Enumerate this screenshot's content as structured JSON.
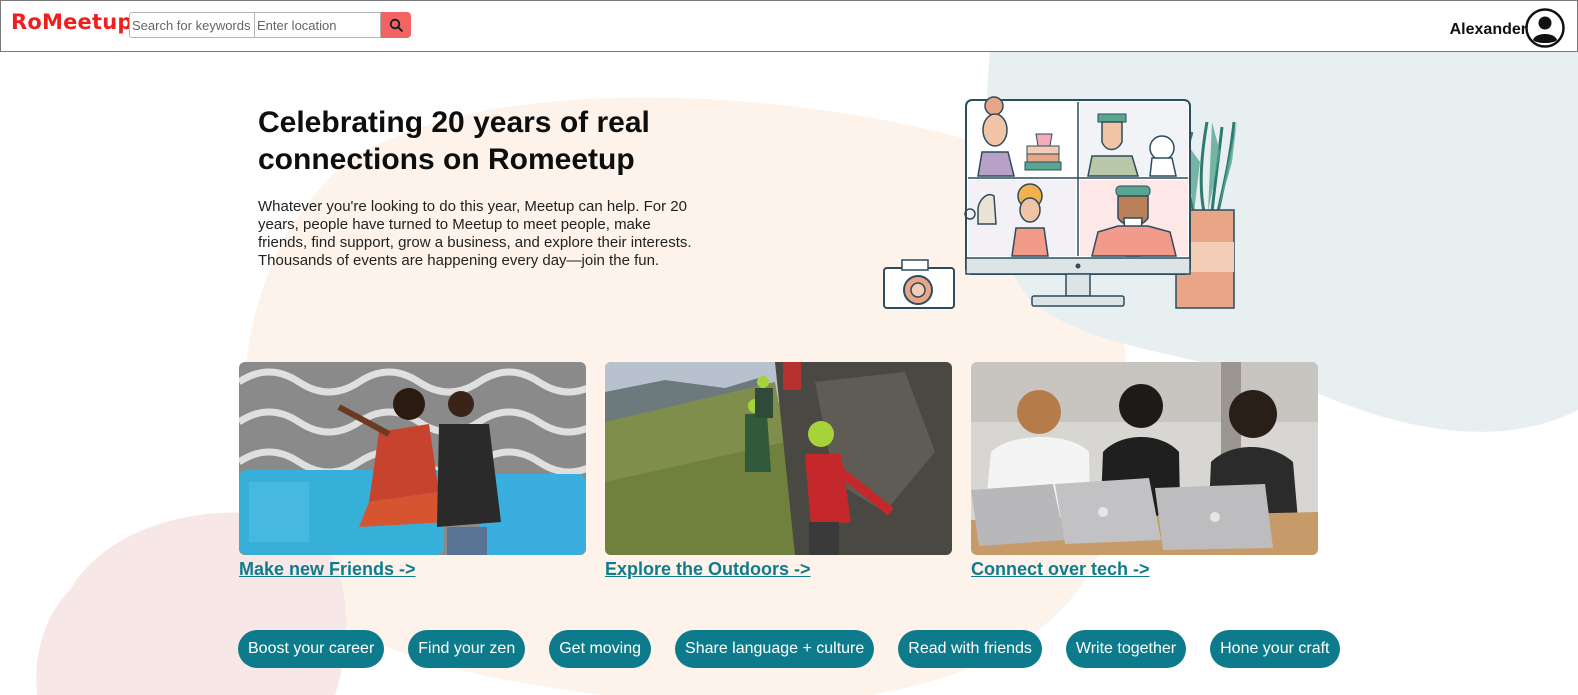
{
  "header": {
    "logo": "RoMeetup",
    "keyword_placeholder": "Search for keywords",
    "location_placeholder": "Enter location",
    "user_name": "Alexander"
  },
  "hero": {
    "title": "Celebrating 20 years of real connections on Romeetup",
    "description": "Whatever you're looking to do this year, Meetup can help. For 20 years, people have turned to Meetup to meet people, make friends, find support, grow a business, and explore their interests. Thousands of events are happening every day—join the fun."
  },
  "cards": [
    {
      "link": "Make new Friends ->",
      "icon": "people-photo"
    },
    {
      "link": "Explore the Outdoors ->",
      "icon": "climbing-photo"
    },
    {
      "link": "Connect over tech ->",
      "icon": "laptops-photo"
    }
  ],
  "topics": [
    "Boost your career",
    "Find your zen",
    "Get moving",
    "Share language + culture",
    "Read with friends",
    "Write together",
    "Hone your craft"
  ],
  "colors": {
    "brand": "#f01f1f",
    "search_button": "#f46363",
    "accent_teal": "#0d7b8b",
    "link": "#0f7c8c"
  }
}
